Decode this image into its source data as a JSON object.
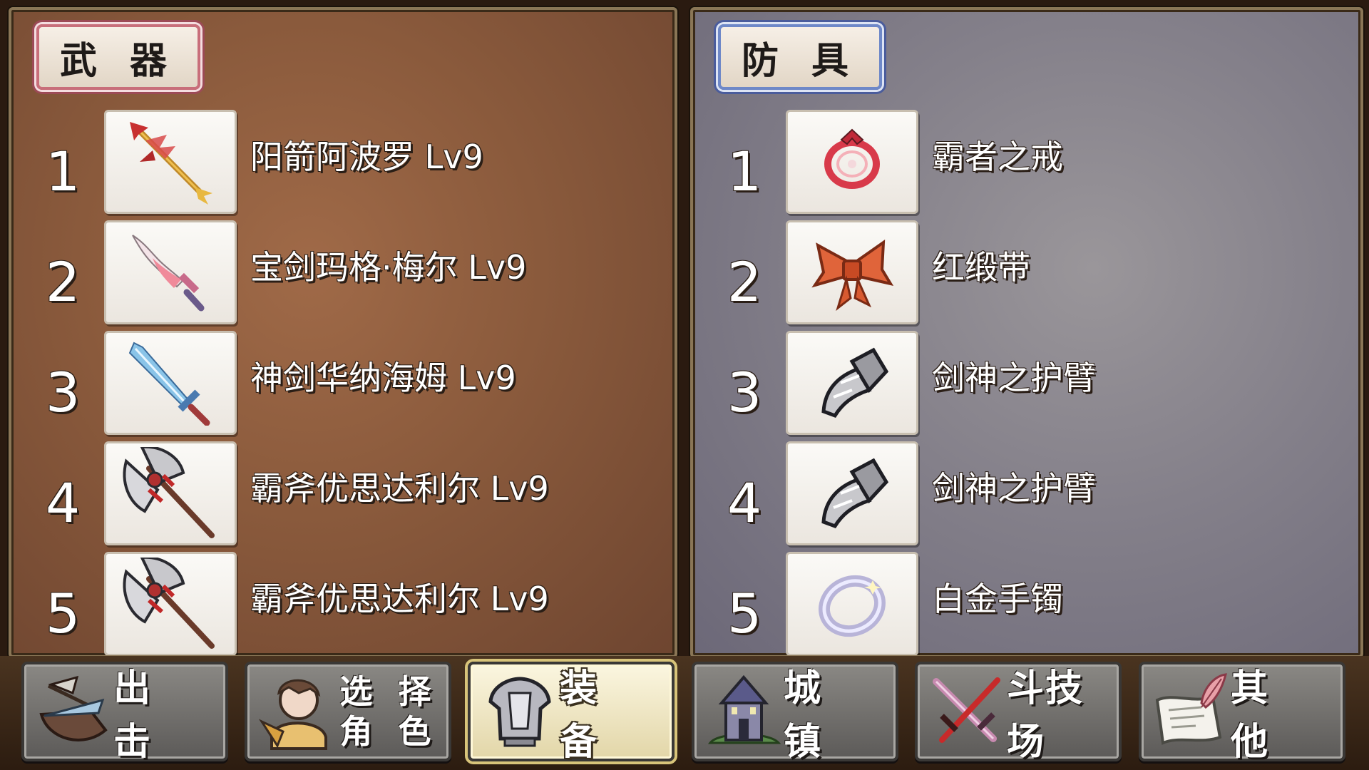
{
  "weapons": {
    "title": "武 器",
    "items": [
      {
        "num": "1",
        "name": "阳箭阿波罗 Lv9",
        "icon": "arrow-icon"
      },
      {
        "num": "2",
        "name": "宝剑玛格·梅尔 Lv9",
        "icon": "pink-sword-icon"
      },
      {
        "num": "3",
        "name": "神剑华纳海姆 Lv9",
        "icon": "blue-sword-icon"
      },
      {
        "num": "4",
        "name": "霸斧优思达利尔 Lv9",
        "icon": "axe-icon"
      },
      {
        "num": "5",
        "name": "霸斧优思达利尔 Lv9",
        "icon": "axe-icon"
      }
    ]
  },
  "armor": {
    "title": "防 具",
    "items": [
      {
        "num": "1",
        "name": "霸者之戒",
        "icon": "ring-icon"
      },
      {
        "num": "2",
        "name": "红缎带",
        "icon": "ribbon-icon"
      },
      {
        "num": "3",
        "name": "剑神之护臂",
        "icon": "gauntlet-icon"
      },
      {
        "num": "4",
        "name": "剑神之护臂",
        "icon": "gauntlet-icon"
      },
      {
        "num": "5",
        "name": "白金手镯",
        "icon": "bracelet-icon"
      }
    ]
  },
  "nav": {
    "sortie": "出 击",
    "select_character": "选 择\n角 色",
    "equipment": "装 备",
    "town": "城 镇",
    "arena": "斗技场",
    "other": "其 他"
  },
  "colors": {
    "weapons_panel": "#8a5a3c",
    "armor_panel": "#84808a",
    "active_button": "#e2d6a8"
  }
}
